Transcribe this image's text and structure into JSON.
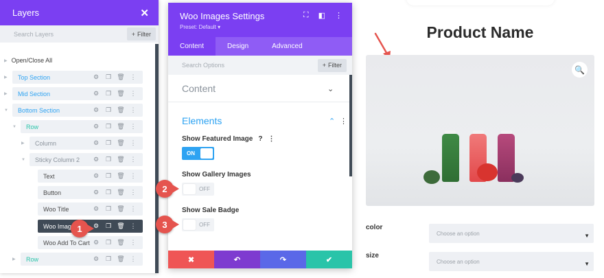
{
  "layers": {
    "title": "Layers",
    "close_icon": "close-icon",
    "search_placeholder": "Search Layers",
    "filter_label": "Filter",
    "open_close_all": "Open/Close All",
    "items": [
      {
        "label": "Top Section",
        "kind": "section"
      },
      {
        "label": "Mid Section",
        "kind": "section"
      },
      {
        "label": "Bottom Section",
        "kind": "section"
      },
      {
        "label": "Row",
        "kind": "row"
      },
      {
        "label": "Column",
        "kind": "column"
      },
      {
        "label": "Sticky Column 2",
        "kind": "column"
      },
      {
        "label": "Text",
        "kind": "module"
      },
      {
        "label": "Button",
        "kind": "module"
      },
      {
        "label": "Woo Title",
        "kind": "module"
      },
      {
        "label": "Woo Images",
        "kind": "module",
        "selected": true
      },
      {
        "label": "Woo Add To Cart",
        "kind": "module"
      },
      {
        "label": "Row",
        "kind": "row"
      }
    ]
  },
  "settings": {
    "title": "Woo Images Settings",
    "preset": "Preset: Default",
    "tabs": [
      "Content",
      "Design",
      "Advanced"
    ],
    "active_tab": "Content",
    "search_placeholder": "Search Options",
    "filter_label": "Filter",
    "groups": {
      "content": "Content",
      "elements": "Elements"
    },
    "fields": [
      {
        "label": "Show Featured Image",
        "state": "ON"
      },
      {
        "label": "Show Gallery Images",
        "state": "OFF"
      },
      {
        "label": "Show Sale Badge",
        "state": "OFF"
      }
    ],
    "footer": [
      "discard",
      "undo",
      "redo",
      "save"
    ]
  },
  "markers": [
    "1",
    "2",
    "3"
  ],
  "product": {
    "name": "Product Name",
    "attributes": [
      {
        "label": "color",
        "placeholder": "Choose an option"
      },
      {
        "label": "size",
        "placeholder": "Choose an option"
      }
    ]
  },
  "colors": {
    "purple": "#7b3ff2",
    "purple_light": "#8f5cf5",
    "blue": "#2ea3f2",
    "teal": "#29c4a9",
    "red": "#ef5555",
    "violet": "#7e3bd0",
    "indigo": "#5a68e8",
    "green": "#29c4a9",
    "marker": "#e5544e"
  }
}
